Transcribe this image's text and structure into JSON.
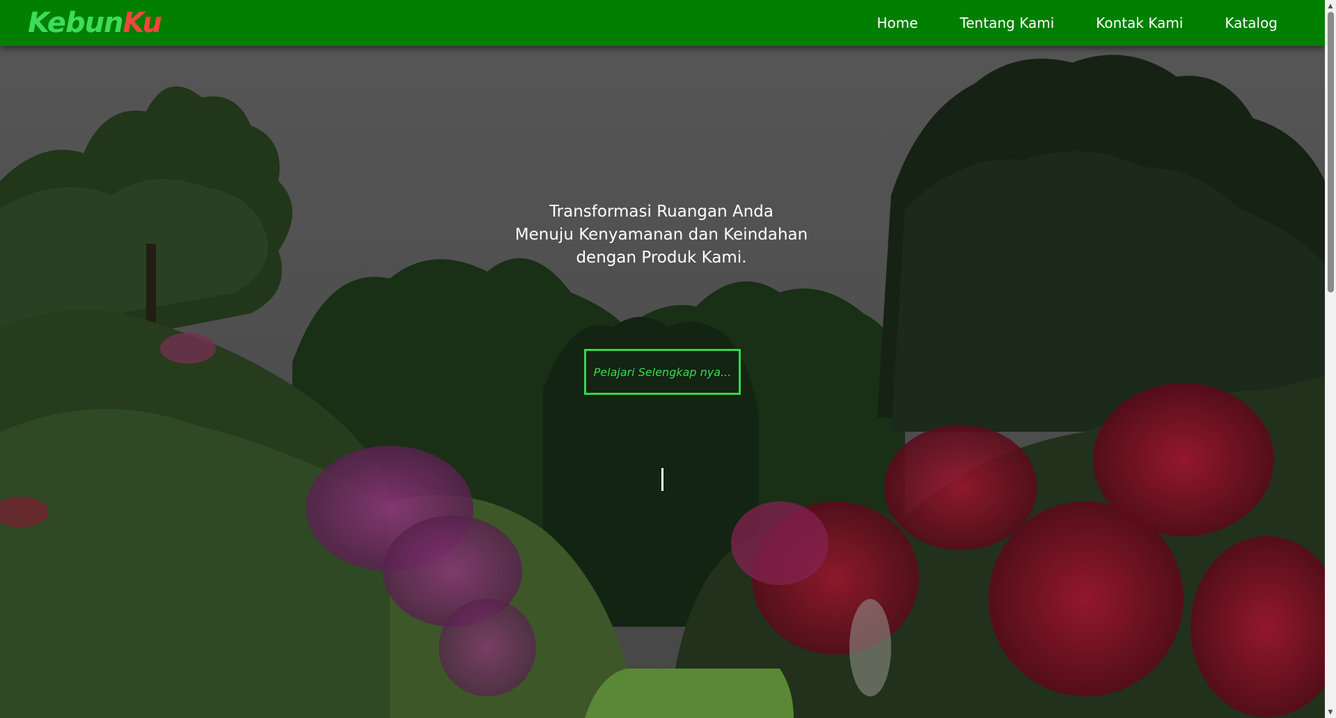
{
  "brand": {
    "part1": "Kebun",
    "part2": "Ku",
    "color_part1": "#3ddc5a",
    "color_part2": "#f2453d"
  },
  "nav": {
    "background": "#017f01",
    "items": [
      {
        "label": "Home"
      },
      {
        "label": "Tentang Kami"
      },
      {
        "label": "Kontak Kami"
      },
      {
        "label": "Katalog"
      }
    ]
  },
  "hero": {
    "headline_lines": [
      "Transformasi Ruangan Anda",
      "Menuju Kenyamanan dan Keindahan",
      "dengan Produk Kami."
    ],
    "cta_label": "Pelajari Selengkap nya...",
    "cta_color": "#35d651",
    "background_description_icon": "garden-photo"
  },
  "scrollbar": {
    "up_icon": "arrow-up-icon",
    "down_icon": "arrow-down-icon"
  }
}
